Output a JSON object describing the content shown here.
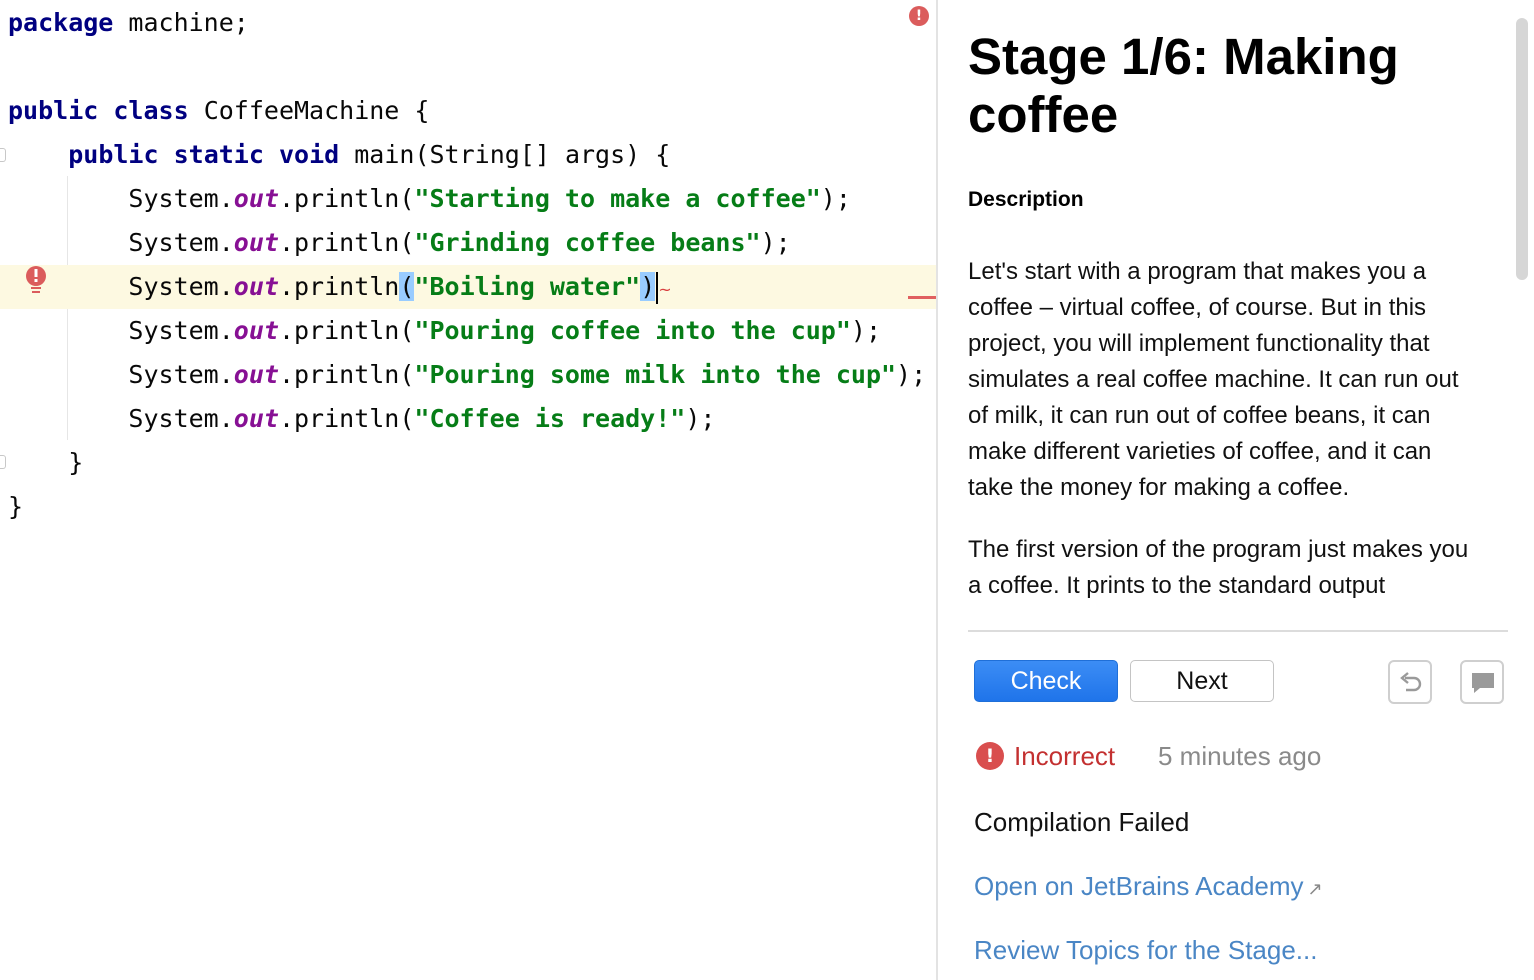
{
  "editor": {
    "lines": [
      {
        "id": "line-package",
        "parts": [
          {
            "cls": "kw",
            "text": "package"
          },
          {
            "cls": "",
            "text": " machine;"
          }
        ]
      },
      {
        "id": "line-blank",
        "parts": []
      },
      {
        "id": "line-class",
        "parts": [
          {
            "cls": "kw",
            "text": "public"
          },
          {
            "cls": "",
            "text": " "
          },
          {
            "cls": "kw",
            "text": "class"
          },
          {
            "cls": "",
            "text": " CoffeeMachine {"
          }
        ]
      },
      {
        "id": "line-main",
        "parts": [
          {
            "cls": "",
            "text": "    "
          },
          {
            "cls": "kw",
            "text": "public"
          },
          {
            "cls": "",
            "text": " "
          },
          {
            "cls": "kw",
            "text": "static"
          },
          {
            "cls": "",
            "text": " "
          },
          {
            "cls": "kw",
            "text": "void"
          },
          {
            "cls": "",
            "text": " main(String[] args) {"
          }
        ]
      },
      {
        "id": "line-print-1",
        "parts": [
          {
            "cls": "",
            "text": "        System."
          },
          {
            "cls": "fld",
            "text": "out"
          },
          {
            "cls": "",
            "text": ".println("
          },
          {
            "cls": "str",
            "text": "\"Starting to make a coffee\""
          },
          {
            "cls": "",
            "text": ");"
          }
        ]
      },
      {
        "id": "line-print-2",
        "parts": [
          {
            "cls": "",
            "text": "        System."
          },
          {
            "cls": "fld",
            "text": "out"
          },
          {
            "cls": "",
            "text": ".println("
          },
          {
            "cls": "str",
            "text": "\"Grinding coffee beans\""
          },
          {
            "cls": "",
            "text": ");"
          }
        ]
      },
      {
        "id": "line-print-3",
        "current": true,
        "parts": [
          {
            "cls": "",
            "text": "        System."
          },
          {
            "cls": "fld",
            "text": "out"
          },
          {
            "cls": "",
            "text": ".println"
          },
          {
            "cls": "brace-hl",
            "text": "("
          },
          {
            "cls": "str",
            "text": "\"Boiling water\""
          },
          {
            "cls": "brace-hl",
            "text": ")"
          },
          {
            "cls": "caret",
            "text": ""
          },
          {
            "cls": "squiggle",
            "text": "~"
          }
        ]
      },
      {
        "id": "line-print-4",
        "parts": [
          {
            "cls": "",
            "text": "        System."
          },
          {
            "cls": "fld",
            "text": "out"
          },
          {
            "cls": "",
            "text": ".println("
          },
          {
            "cls": "str",
            "text": "\"Pouring coffee into the cup\""
          },
          {
            "cls": "",
            "text": ");"
          }
        ]
      },
      {
        "id": "line-print-5",
        "parts": [
          {
            "cls": "",
            "text": "        System."
          },
          {
            "cls": "fld",
            "text": "out"
          },
          {
            "cls": "",
            "text": ".println("
          },
          {
            "cls": "str",
            "text": "\"Pouring some milk into the cup\""
          },
          {
            "cls": "",
            "text": ");"
          }
        ]
      },
      {
        "id": "line-print-6",
        "parts": [
          {
            "cls": "",
            "text": "        System."
          },
          {
            "cls": "fld",
            "text": "out"
          },
          {
            "cls": "",
            "text": ".println("
          },
          {
            "cls": "str",
            "text": "\"Coffee is ready!\""
          },
          {
            "cls": "",
            "text": ");"
          }
        ]
      },
      {
        "id": "line-close-main",
        "parts": [
          {
            "cls": "",
            "text": "    }"
          }
        ]
      },
      {
        "id": "line-close-class",
        "parts": [
          {
            "cls": "",
            "text": "}"
          }
        ]
      }
    ],
    "error_marker_icon": "error-circle-icon",
    "gutter_icon": "error-bulb-icon"
  },
  "task": {
    "title": "Stage 1/6: Making coffee",
    "description_heading": "Description",
    "paragraphs": [
      "Let's start with a program that makes you a coffee – virtual coffee, of course. But in this project, you will implement functionality that simulates a real coffee machine. It can run out of milk, it can run out of coffee beans, it can make different varieties of coffee, and it can take the money for making a coffee.",
      "The first version of the program just makes you a coffee. It prints to the standard output"
    ],
    "check_label": "Check",
    "next_label": "Next",
    "reset_icon": "undo-icon",
    "comment_icon": "comment-icon",
    "status": {
      "label": "Incorrect",
      "time": "5 minutes ago",
      "icon": "error-circle-icon",
      "color": "#c33030"
    },
    "message": "Compilation Failed",
    "links": [
      {
        "label": "Open on JetBrains Academy",
        "external": true
      },
      {
        "label": "Review Topics for the Stage..."
      }
    ]
  },
  "colors": {
    "keyword": "#000080",
    "string": "#067d17",
    "field": "#871094",
    "check_button": "#2a7ff0",
    "link": "#4a86c5",
    "current_line": "#fdf9e1"
  }
}
